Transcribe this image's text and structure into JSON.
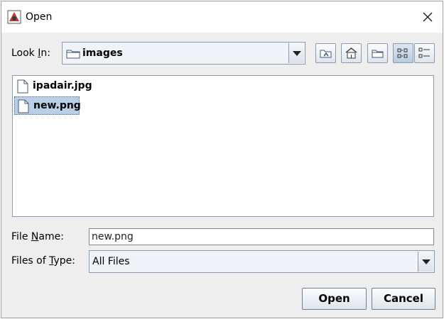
{
  "window": {
    "title": "Open"
  },
  "look_in": {
    "label": "Look In:",
    "mnemonic": "L",
    "value": "images"
  },
  "toolbar": [
    {
      "name": "up-one-level",
      "icon": "folder-up-icon"
    },
    {
      "name": "home",
      "icon": "home-icon"
    },
    {
      "name": "create-new-folder",
      "icon": "new-folder-icon"
    },
    {
      "name": "list-view",
      "icon": "list-view-icon",
      "selected": true
    },
    {
      "name": "details-view",
      "icon": "details-view-icon",
      "selected": false
    }
  ],
  "files": [
    {
      "name": "ipadair.jpg",
      "selected": false
    },
    {
      "name": "new.png",
      "selected": true
    }
  ],
  "file_name": {
    "label": "File Name:",
    "mnemonic": "N",
    "value": "new.png"
  },
  "file_type": {
    "label": "Files of Type:",
    "mnemonic": "T",
    "value": "All Files"
  },
  "buttons": {
    "open": "Open",
    "cancel": "Cancel"
  },
  "colors": {
    "selection": "#b8cfe5",
    "dialog_bg": "#eeeeee",
    "border": "#8a9bb0"
  }
}
